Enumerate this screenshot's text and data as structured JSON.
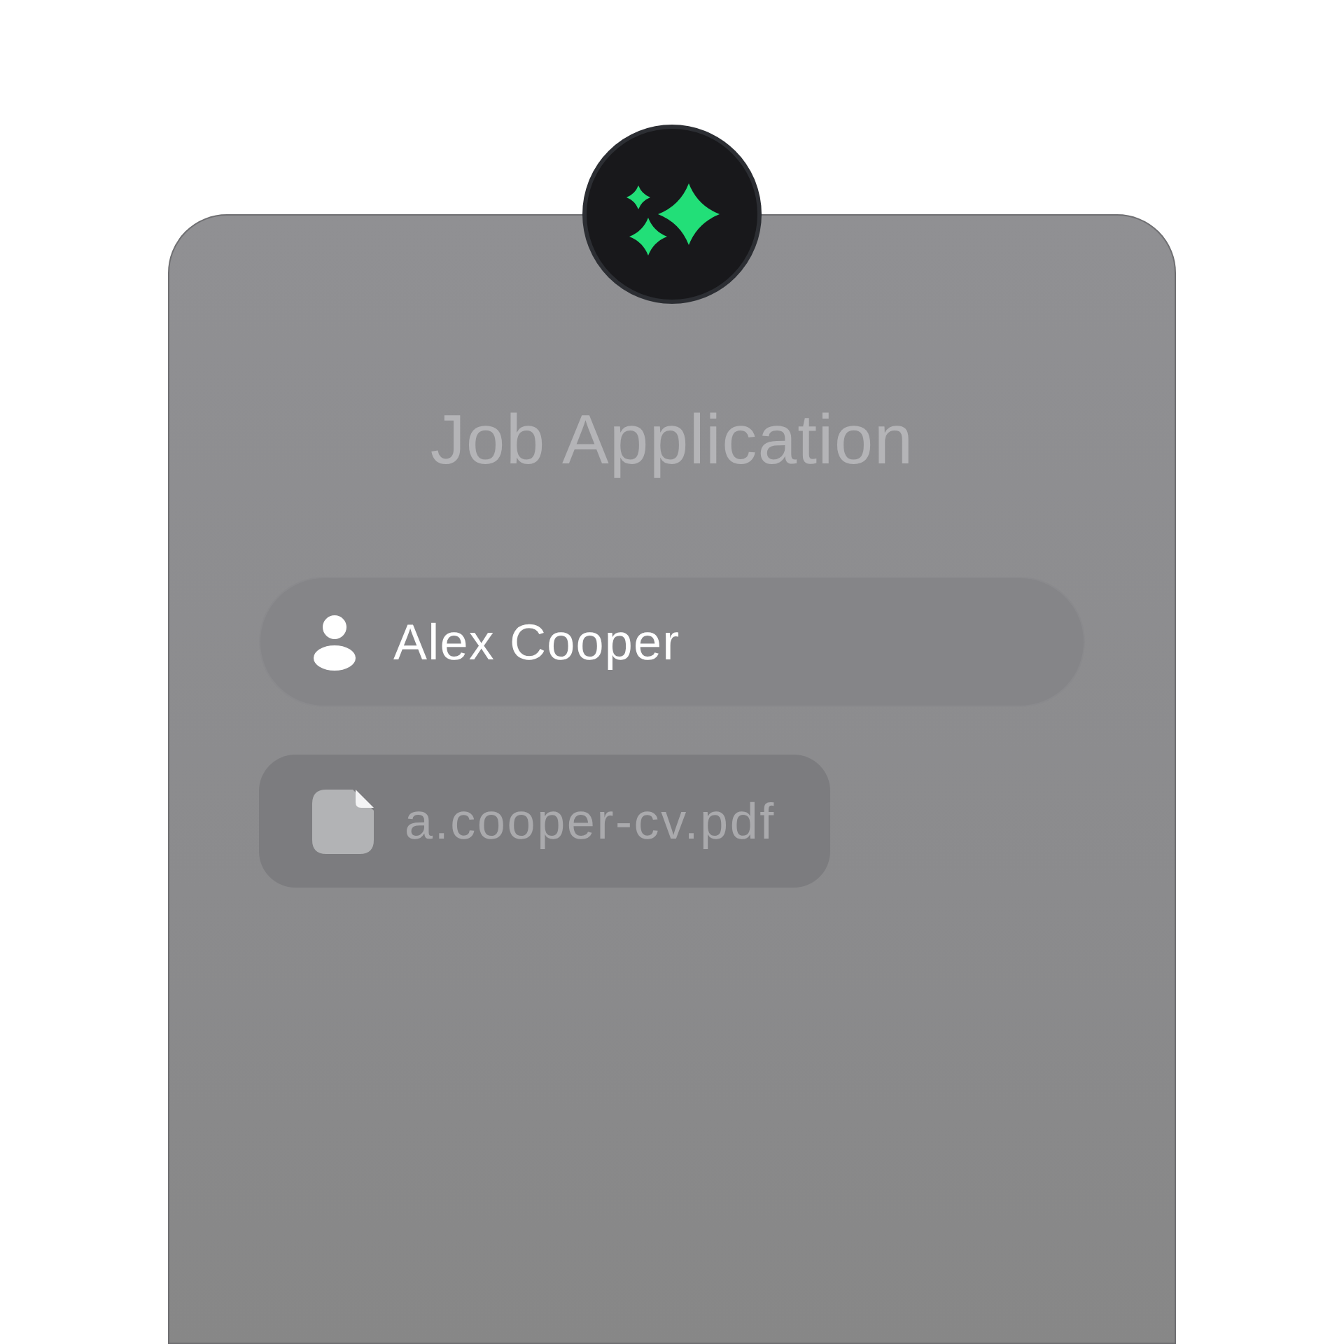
{
  "form": {
    "title": "Job Application",
    "fields": [
      {
        "kind": "name",
        "value": "Alex Cooper"
      },
      {
        "kind": "file",
        "value": "a.cooper-cv.pdf"
      }
    ]
  }
}
